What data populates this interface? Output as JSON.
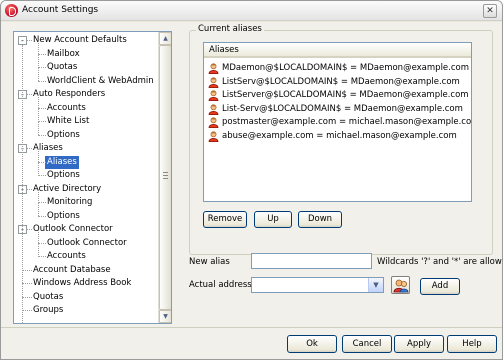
{
  "window": {
    "title": "Account Settings",
    "close_glyph": "✕"
  },
  "tree": {
    "items": [
      {
        "label": "New Account Defaults",
        "level": 0,
        "expander": "-"
      },
      {
        "label": "Mailbox",
        "level": 1
      },
      {
        "label": "Quotas",
        "level": 1
      },
      {
        "label": "WorldClient & WebAdmin",
        "level": 1
      },
      {
        "label": "Auto Responders",
        "level": 0,
        "expander": "-"
      },
      {
        "label": "Accounts",
        "level": 1
      },
      {
        "label": "White List",
        "level": 1
      },
      {
        "label": "Options",
        "level": 1
      },
      {
        "label": "Aliases",
        "level": 0,
        "expander": "-"
      },
      {
        "label": "Aliases",
        "level": 1,
        "selected": true
      },
      {
        "label": "Options",
        "level": 1
      },
      {
        "label": "Active Directory",
        "level": 0,
        "expander": "-"
      },
      {
        "label": "Monitoring",
        "level": 1
      },
      {
        "label": "Options",
        "level": 1
      },
      {
        "label": "Outlook Connector",
        "level": 0,
        "expander": "-"
      },
      {
        "label": "Outlook Connector",
        "level": 1
      },
      {
        "label": "Accounts",
        "level": 1
      },
      {
        "label": "Account Database",
        "level": 0
      },
      {
        "label": "Windows Address Book",
        "level": 0
      },
      {
        "label": "Quotas",
        "level": 0
      },
      {
        "label": "Groups",
        "level": 0
      }
    ],
    "scroll_up": "▲",
    "scroll_down": "▼"
  },
  "aliases": {
    "group_title": "Current aliases",
    "list_header": "Aliases",
    "rows": [
      "MDaemon@$LOCALDOMAIN$ = MDaemon@example.com",
      "ListServ@$LOCALDOMAIN$ = MDaemon@example.com",
      "ListServer@$LOCALDOMAIN$ = MDaemon@example.com",
      "List-Serv@$LOCALDOMAIN$ = MDaemon@example.com",
      "postmaster@example.com = michael.mason@example.com",
      "abuse@example.com = michael.mason@example.com"
    ],
    "remove_label": "Remove",
    "up_label": "Up",
    "down_label": "Down"
  },
  "form": {
    "new_alias_label": "New alias",
    "new_alias_value": "",
    "wildcard_hint": "Wildcards '?' and '*' are allowed.",
    "actual_address_label": "Actual address",
    "actual_address_value": "",
    "dropdown_glyph": "▼",
    "add_label": "Add"
  },
  "footer": {
    "ok_label": "Ok",
    "cancel_label": "Cancel",
    "apply_label": "Apply",
    "help_label": "Help"
  },
  "colors": {
    "selection": "#316ac5",
    "accent": "#003c74"
  }
}
